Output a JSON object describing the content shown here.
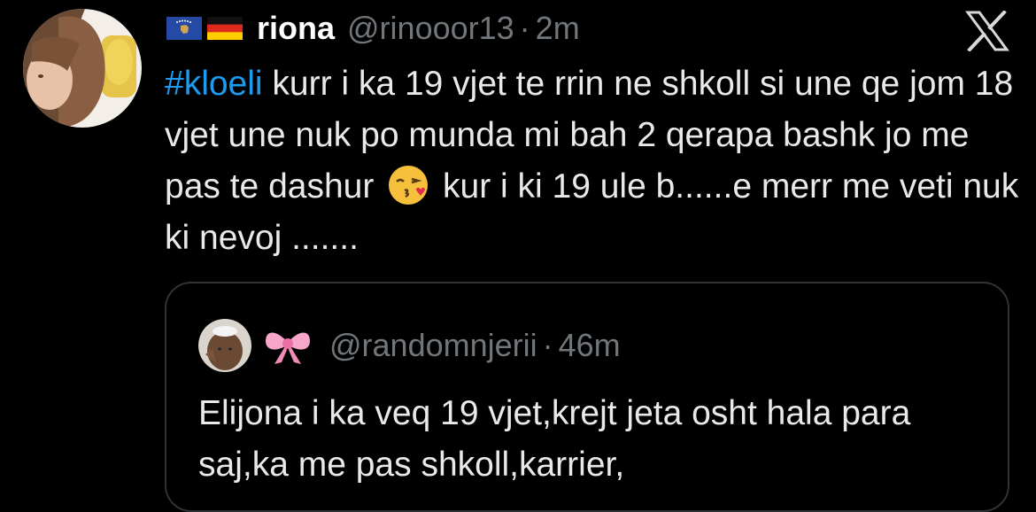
{
  "tweet": {
    "flags": [
      "kosovo-flag-icon",
      "germany-flag-icon"
    ],
    "display_name": "riona",
    "handle": "@rinooor13",
    "separator": "·",
    "time": "2m",
    "text_hashtag": "#kloeli",
    "text_part1": " kurr i ka 19 vjet te rrin ne shkoll si une qe jom 18 vjet une nuk po munda mi bah 2 qerapa bashk jo me pas te dashur ",
    "emoji": "face-blowing-kiss-icon",
    "text_part2": " kur i ki 19 ule b......e merr me veti nuk ki nevoj ......."
  },
  "quote": {
    "bow_icon": "pink-bow-icon",
    "handle": "@randomnjerii",
    "separator": "·",
    "time": "46m",
    "text": "Elijona i ka veq 19 vjet,krejt jeta osht hala para saj,ka me pas shkoll,karrier,"
  },
  "colors": {
    "background": "#000000",
    "text": "#e7e9ea",
    "secondary": "#71767b",
    "link": "#1d9bf0",
    "border": "#2f3336"
  }
}
